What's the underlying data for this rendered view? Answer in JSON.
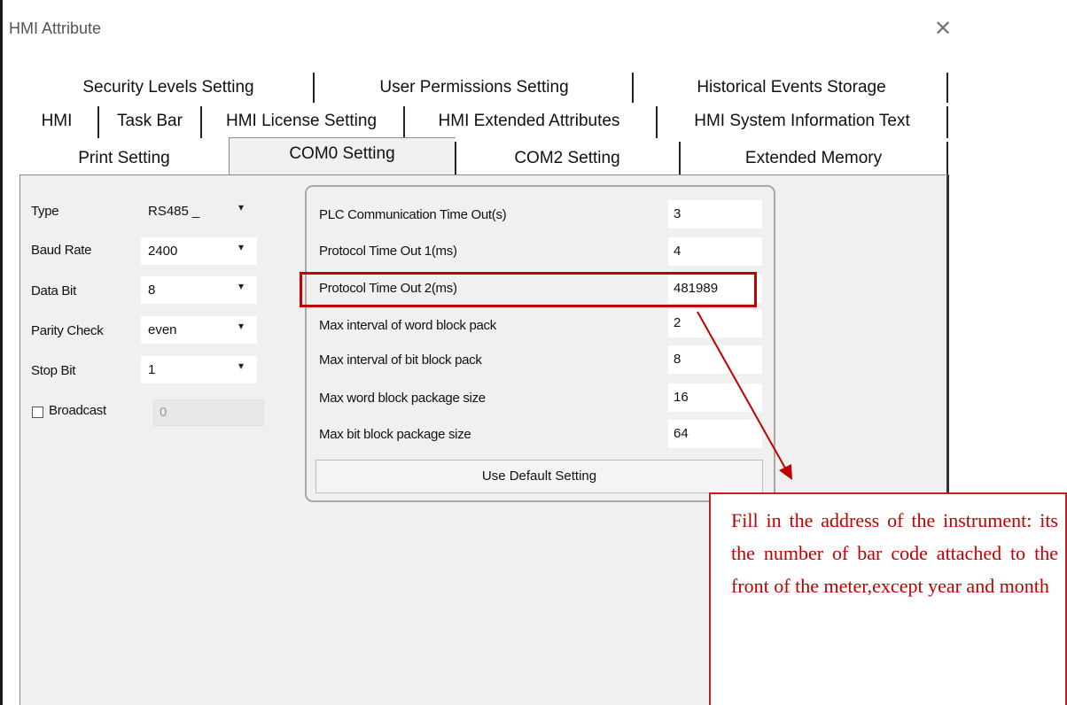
{
  "window": {
    "title": "HMI Attribute",
    "close_glyph": "✕"
  },
  "tabs": {
    "row1": [
      "Security Levels Setting",
      "User Permissions Setting",
      "Historical Events Storage"
    ],
    "row2": [
      "HMI",
      "Task Bar",
      "HMI License Setting",
      "HMI Extended Attributes",
      "HMI System Information Text"
    ],
    "row3": [
      "Print Setting",
      "COM0 Setting",
      "COM2 Setting",
      "Extended Memory"
    ],
    "active": "COM0 Setting"
  },
  "com_settings": {
    "type": {
      "label": "Type",
      "value": "RS485 _"
    },
    "baud_rate": {
      "label": "Baud Rate",
      "value": "2400"
    },
    "data_bit": {
      "label": "Data Bit",
      "value": "8"
    },
    "parity_check": {
      "label": "Parity Check",
      "value": "even"
    },
    "stop_bit": {
      "label": "Stop Bit",
      "value": "1"
    },
    "broadcast": {
      "label": "Broadcast",
      "checked": false,
      "value": "0"
    }
  },
  "protocol": {
    "rows": [
      {
        "label": "PLC Communication Time Out(s)",
        "value": "3"
      },
      {
        "label": "Protocol Time Out 1(ms)",
        "value": "4"
      },
      {
        "label": "Protocol Time Out 2(ms)",
        "value": "481989"
      },
      {
        "label": "Max interval of word block pack",
        "value": "2"
      },
      {
        "label": "Max interval of bit block pack",
        "value": "8"
      },
      {
        "label": "Max word block package size",
        "value": "16"
      },
      {
        "label": "Max bit block package size",
        "value": "64"
      }
    ],
    "default_button": "Use Default Setting"
  },
  "annotation": {
    "text": "Fill in the address of the instrument: its the number of bar code attached to the front of the meter,except year and month",
    "color": "#c00000"
  }
}
